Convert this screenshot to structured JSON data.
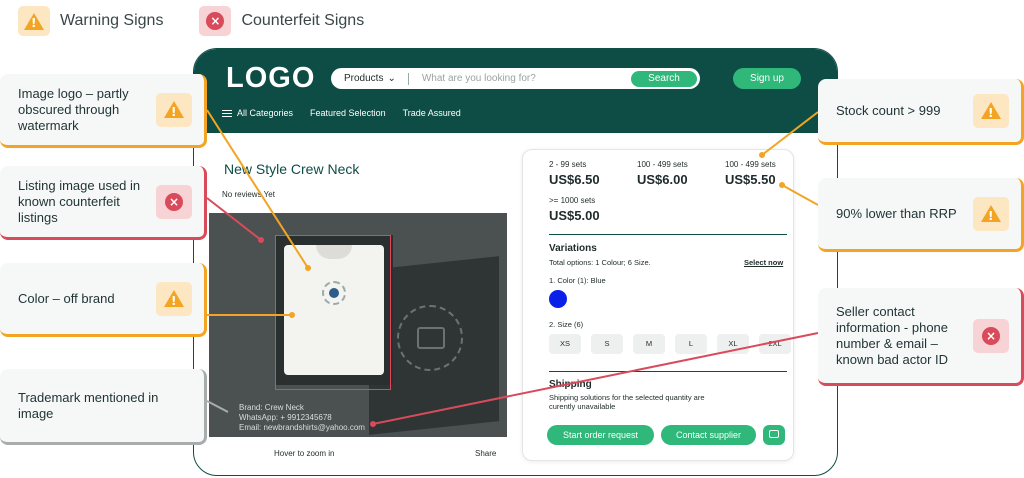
{
  "legend": {
    "warning": "Warning Signs",
    "counterfeit": "Counterfeit Signs"
  },
  "header": {
    "logo": "LOGO",
    "search": {
      "category": "Products",
      "placeholder": "What are you looking for?",
      "button": "Search"
    },
    "signup": "Sign up",
    "nav": [
      "All Categories",
      "Featured Selection",
      "Trade Assured"
    ]
  },
  "product": {
    "title": "New Style Crew Neck",
    "reviews": "No reviews Yet",
    "image_text": [
      "Brand: Crew Neck",
      "WhatsApp: + 9912345678",
      "Email: newbrandshirts@yahoo.com"
    ],
    "hover_zoom": "Hover to zoom in",
    "share": "Share"
  },
  "pricing": {
    "tiers": [
      {
        "range": "2 - 99 sets",
        "price": "US$6.50"
      },
      {
        "range": "100 - 499 sets",
        "price": "US$6.00"
      },
      {
        "range": "100 - 499 sets",
        "price": "US$5.50"
      },
      {
        "range": ">= 1000 sets",
        "price": "US$5.00"
      }
    ],
    "variations_title": "Variations",
    "variations_options": "Total options: 1 Colour; 6 Size.",
    "select_now": "Select now",
    "color_label": "1. Color (1): Blue",
    "color_hex": "#0a20e8",
    "size_label": "2. Size (6)",
    "sizes": [
      "XS",
      "S",
      "M",
      "L",
      "XL",
      "2XL"
    ],
    "shipping_title": "Shipping",
    "shipping_text": "Shipping solutions for the selected quantity are curently unavailable",
    "start_order": "Start order request",
    "contact_supplier": "Contact supplier"
  },
  "callouts": {
    "image_logo": "Image logo – partly obscured through watermark",
    "listing_image": "Listing image used in known counterfeit listings",
    "color": "Color – off brand",
    "trademark": "Trademark mentioned in image",
    "stock_count": "Stock count > 999",
    "rrp": "90% lower than RRP",
    "seller_contact": "Seller contact information - phone number & email – known bad actor ID"
  },
  "colors": {
    "warning": "#f3a423",
    "counterfeit": "#d94a5b",
    "brand": "#0e4d45",
    "accent": "#2fb87a"
  }
}
